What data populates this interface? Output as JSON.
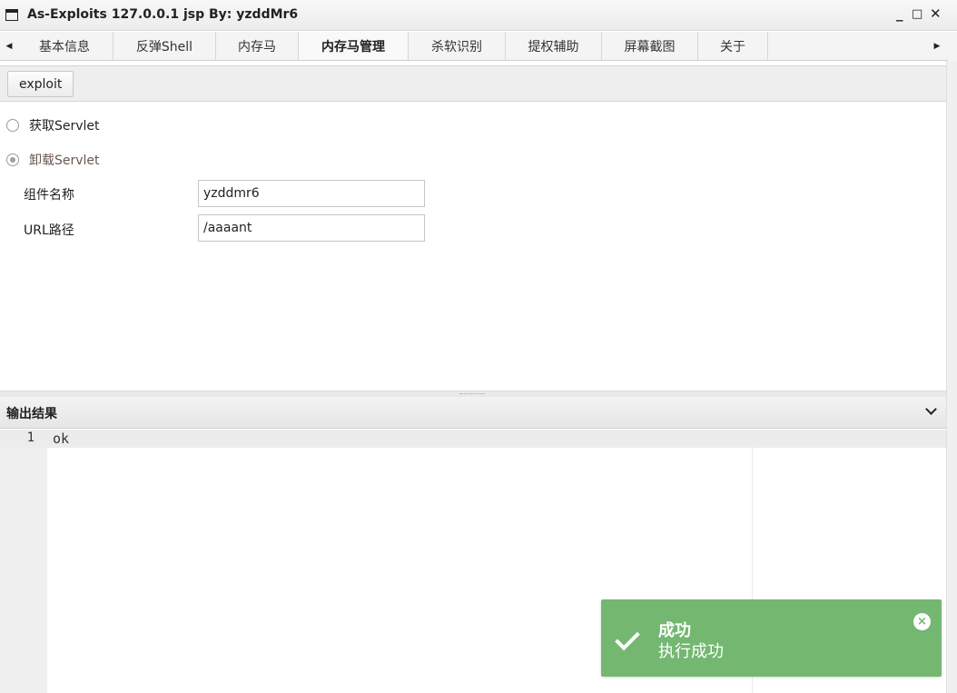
{
  "window": {
    "title": "As-Exploits 127.0.0.1 jsp By: yzddMr6",
    "minimize_glyph": "_",
    "maximize_glyph": "□",
    "close_glyph": "✕"
  },
  "tabs": {
    "scroll_left_glyph": "◀",
    "scroll_right_glyph": "▶",
    "items": [
      {
        "label": "基本信息",
        "active": false
      },
      {
        "label": "反弹Shell",
        "active": false
      },
      {
        "label": "内存马",
        "active": false
      },
      {
        "label": "内存马管理",
        "active": true
      },
      {
        "label": "杀软识别",
        "active": false
      },
      {
        "label": "提权辅助",
        "active": false
      },
      {
        "label": "屏幕截图",
        "active": false
      },
      {
        "label": "关于",
        "active": false
      }
    ]
  },
  "toolbar": {
    "exploit_label": "exploit"
  },
  "form": {
    "radio_get": {
      "label": "获取Servlet",
      "checked": false
    },
    "radio_unload": {
      "label": "卸载Servlet",
      "checked": true
    },
    "component_name": {
      "label": "组件名称",
      "value": "yzddmr6"
    },
    "url_path": {
      "label": "URL路径",
      "value": "/aaaant"
    }
  },
  "output": {
    "title": "输出结果",
    "lines": [
      {
        "number": "1",
        "text": "ok"
      }
    ]
  },
  "toast": {
    "title": "成功",
    "message": "执行成功",
    "close_glyph": "×",
    "color": "#74b771"
  }
}
